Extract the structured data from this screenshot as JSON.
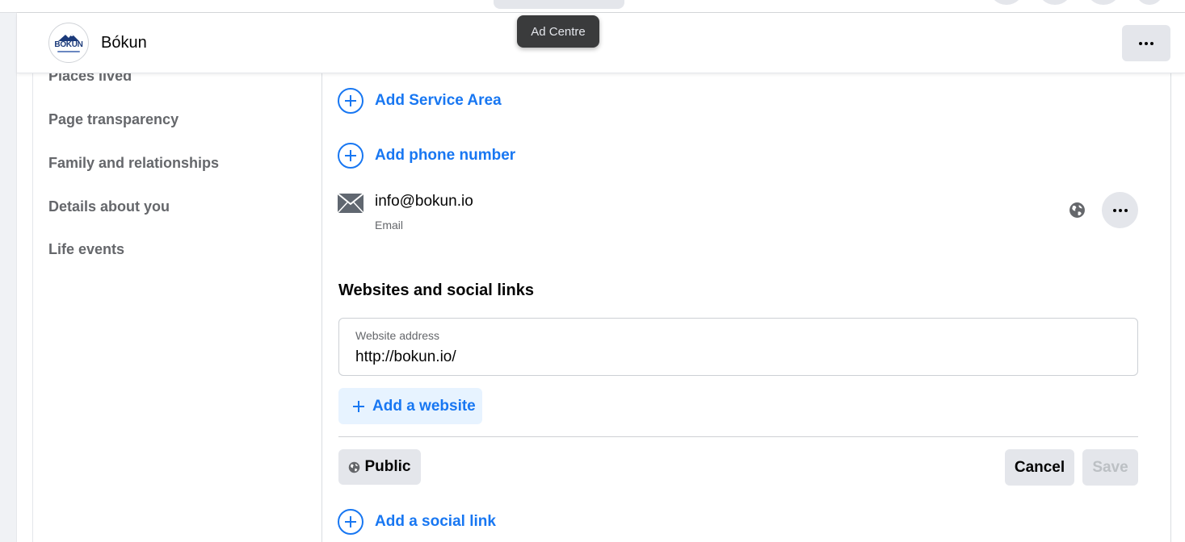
{
  "page": {
    "name": "Bókun",
    "avatar_logo_text": "BÓKUN",
    "more_button_icon": "more-icon"
  },
  "tooltip": {
    "text": "Ad Centre"
  },
  "sidebar": {
    "items": [
      {
        "label": "Places lived"
      },
      {
        "label": "Page transparency"
      },
      {
        "label": "Family and relationships"
      },
      {
        "label": "Details about you"
      },
      {
        "label": "Life events"
      }
    ]
  },
  "contact": {
    "add_service_area": "Add Service Area",
    "add_phone": "Add phone number",
    "email": {
      "value": "info@bokun.io",
      "type": "Email",
      "icon": "envelope-icon",
      "privacy_icon": "globe-icon"
    }
  },
  "websites": {
    "title": "Websites and social links",
    "field_label": "Website address",
    "field_value": "http://bokun.io/",
    "add_website": "Add a website",
    "privacy": "Public",
    "cancel": "Cancel",
    "save": "Save",
    "add_social_link": "Add a social link"
  },
  "colors": {
    "accent": "#1877f2",
    "button_bg": "#e4e6eb",
    "secondary_text": "#65676b",
    "tooltip_bg": "#3a3b3c"
  }
}
